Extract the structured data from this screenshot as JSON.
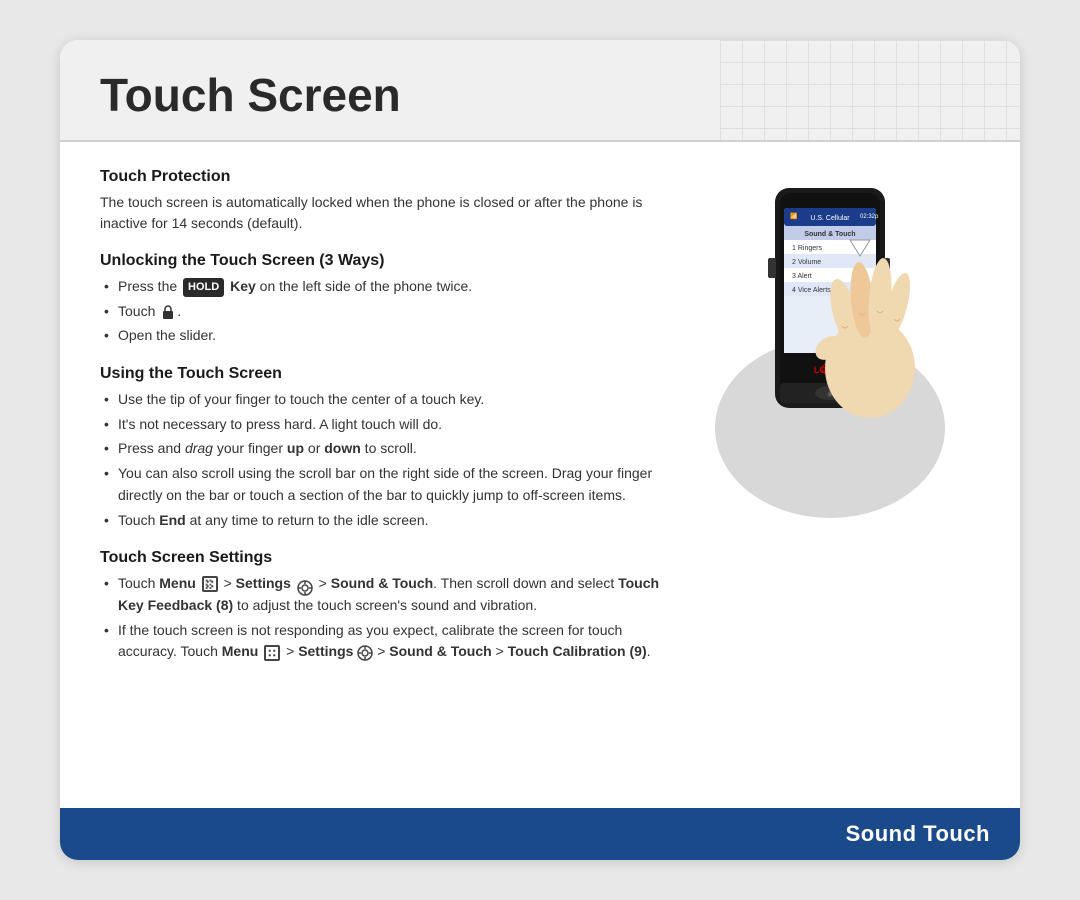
{
  "header": {
    "title": "Touch Screen"
  },
  "sections": [
    {
      "id": "touch-protection",
      "title": "Touch Protection",
      "body": "The touch screen is automatically locked when the phone is closed or after the phone is inactive for 14 seconds (default).",
      "items": []
    },
    {
      "id": "unlocking",
      "title": "Unlocking the Touch Screen (3 Ways)",
      "body": "",
      "items": [
        "Press the HOLD Key on the left side of the phone twice.",
        "Touch 🔒.",
        "Open the slider."
      ]
    },
    {
      "id": "using",
      "title": "Using the Touch Screen",
      "body": "",
      "items": [
        "Use the tip of your finger to touch the center of a touch key.",
        "It's not necessary to press hard. A light touch will do.",
        "Press and drag your finger up or down to scroll.",
        "You can also scroll using the scroll bar on the right side of the screen. Drag your finger directly on the bar or touch a section of the bar to quickly jump to off-screen items.",
        "Touch End at any time to return to the idle screen."
      ]
    },
    {
      "id": "settings",
      "title": "Touch Screen Settings",
      "body": "",
      "items": [
        "Touch Menu > Settings > Sound & Touch. Then scroll down and select Touch Key Feedback (8) to adjust the touch screen's sound and vibration.",
        "If the touch screen is not responding as you expect, calibrate the screen for touch accuracy. Touch Menu > Settings > Sound & Touch > Touch Calibration (9)."
      ]
    }
  ],
  "footer": {
    "label": "Sound Touch"
  }
}
